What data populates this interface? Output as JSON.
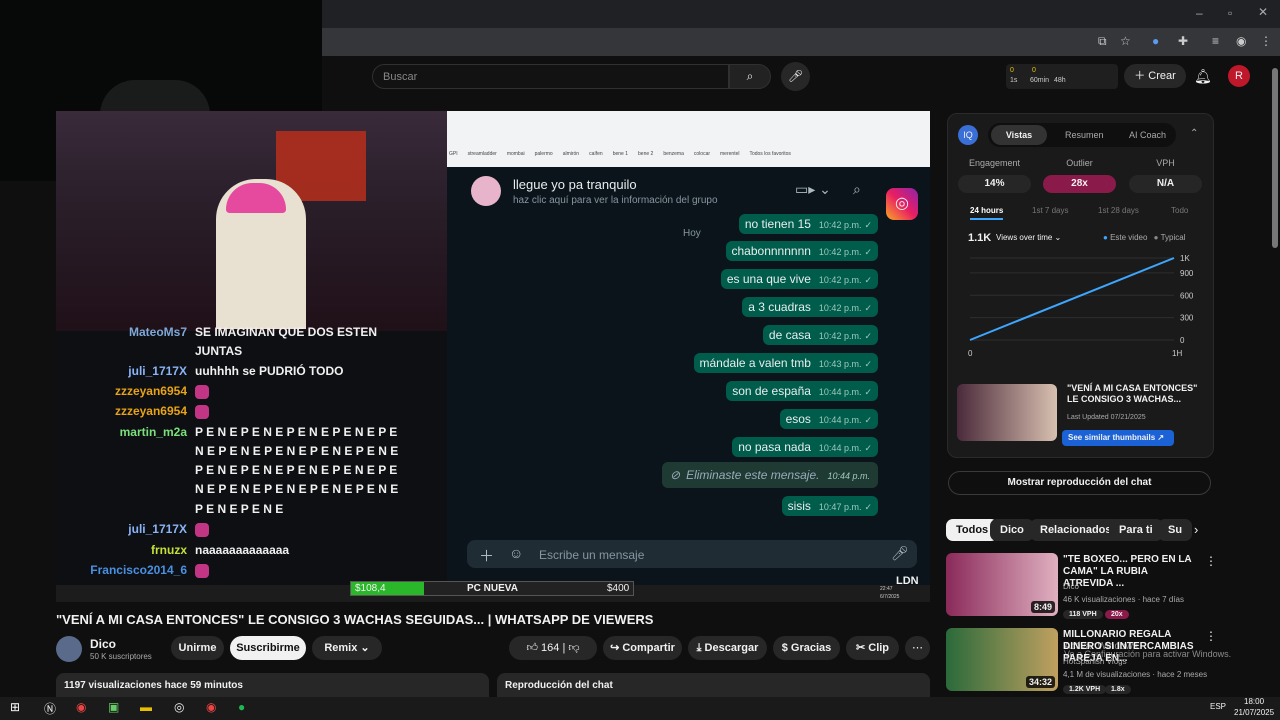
{
  "youtube": {
    "search_placeholder": "Buscar",
    "create_label": "Crear",
    "avatar_letter": "R",
    "ext_stats": [
      "0",
      "0",
      "0",
      "0",
      "1s",
      "60min",
      "48h"
    ]
  },
  "video": {
    "title": "\"VENÍ A MI CASA ENTONCES\" LE CONSIGO 3 WACHAS SEGUIDAS... | WHATSAPP DE VIEWERS",
    "channel": "Dico",
    "subs": "50 K suscriptores",
    "join": "Unirme",
    "subscribe": "Suscribirme",
    "remix": "Remix",
    "likes": "164",
    "share": "Compartir",
    "download": "Descargar",
    "thanks": "Gracias",
    "clip": "Clip",
    "views_line": "1197 visualizaciones  hace 59 minutos",
    "chat_replay": "Reproducción del chat"
  },
  "stream_chat": [
    {
      "user": "MateoMs7",
      "msg": "SE IMAGINAN QUE DOS ESTEN",
      "color": "#7fa8d8"
    },
    {
      "user": "",
      "msg": "JUNTAS",
      "color": "#7fa8d8"
    },
    {
      "user": "juli_1717X",
      "msg": "uuhhhh se PUDRIÓ TODO",
      "color": "#8ab4f8"
    },
    {
      "user": "zzzeyan6954",
      "msg": "",
      "color": "#e8a317"
    },
    {
      "user": "zzzeyan6954",
      "msg": "",
      "color": "#e8a317"
    },
    {
      "user": "martin_m2a",
      "msg": "P E N E P E N E P E N E P E N E P E",
      "color": "#7be07b"
    },
    {
      "user": "",
      "msg": "N E P E N E P E N E P E N E P E N E",
      "color": "#7be07b"
    },
    {
      "user": "",
      "msg": "P E N E P E N E P E N E P E N E P E",
      "color": "#7be07b"
    },
    {
      "user": "",
      "msg": "N E P E N E P E N E P E N E P E N E",
      "color": "#7be07b"
    },
    {
      "user": "",
      "msg": "P E N E P E N E",
      "color": "#7be07b"
    },
    {
      "user": "juli_1717X",
      "msg": "",
      "color": "#8ab4f8"
    },
    {
      "user": "frnuzx",
      "msg": "naaaaaaaaaaaaa",
      "color": "#c6e03b"
    },
    {
      "user": "Francisco2014_6",
      "msg": "",
      "color": "#4a90e2"
    }
  ],
  "whatsapp": {
    "contact": "llegue yo pa tranquilo",
    "subtitle": "haz clic aquí para ver la información del grupo",
    "day": "Hoy",
    "input_placeholder": "Escribe un mensaje",
    "deleted": "Eliminaste este mensaje.",
    "messages": [
      {
        "text": "no tienen 15",
        "time": "10:42 p.m."
      },
      {
        "text": "chabonnnnnnn",
        "time": "10:42 p.m."
      },
      {
        "text": "es una que vive",
        "time": "10:42 p.m."
      },
      {
        "text": "a 3 cuadras",
        "time": "10:42 p.m."
      },
      {
        "text": "de casa",
        "time": "10:42 p.m."
      },
      {
        "text": "mándale a valen tmb",
        "time": "10:43 p.m."
      },
      {
        "text": "son de españa",
        "time": "10:44 p.m."
      },
      {
        "text": "esos",
        "time": "10:44 p.m."
      },
      {
        "text": "no pasa nada",
        "time": "10:44 p.m."
      },
      {
        "text": "Eliminaste este mensaje.",
        "time": "10:44 p.m."
      },
      {
        "text": "sisis",
        "time": "10:47 p.m."
      }
    ],
    "bookmarks": [
      "GPI",
      "streamladder",
      "mombai",
      "palermo",
      "almirón",
      "caífen",
      "bene 1",
      "bene 2",
      "benzema",
      "colocar",
      "merentel",
      "Todos los favoritos"
    ]
  },
  "stream_overlay": {
    "money1": "$108,4",
    "label": "PC NUEVA",
    "money2": "$400",
    "time": "22:47",
    "date": "6/7/2025",
    "ldn": "LDN"
  },
  "sidepanel": {
    "tabs": [
      "Vistas",
      "Resumen",
      "AI Coach"
    ],
    "metrics": [
      {
        "label": "Engagement",
        "value": "14%"
      },
      {
        "label": "Outlier",
        "value": "28x"
      },
      {
        "label": "VPH",
        "value": "N/A"
      }
    ],
    "ranges": [
      "24 hours",
      "1st 7 days",
      "1st 28 days",
      "Todo"
    ],
    "views": "1.1K",
    "views_sel": "Views over time",
    "legend": [
      "Este video",
      "Typical"
    ],
    "y_ticks": [
      "1K",
      "900",
      "600",
      "300",
      "0"
    ],
    "x_ticks": [
      "0",
      "1H"
    ],
    "card_title": "\"VENÍ A MI CASA ENTONCES\" LE CONSIGO 3 WACHAS...",
    "card_updated": "Last Updated 07/21/2025",
    "card_button": "See similar thumbnails"
  },
  "chart_data": {
    "type": "line",
    "x": [
      0,
      1
    ],
    "series": [
      {
        "name": "Este video",
        "values": [
          0,
          1100
        ]
      }
    ],
    "xlabel": "",
    "ylabel": "",
    "ylim": [
      0,
      1100
    ],
    "x_ticks": [
      "0",
      "1H"
    ],
    "y_ticks": [
      "0",
      "300",
      "600",
      "900",
      "1K"
    ]
  },
  "replay_button": "Mostrar reproducción del chat",
  "filters": [
    "Todos",
    "Dico",
    "Relacionados",
    "Para ti",
    "Su"
  ],
  "recs": [
    {
      "title": "\"TE BOXEO... PERO EN LA CAMA\" LA RUBIA ATREVIDA ...",
      "channel": "Dico",
      "meta": "46 K visualizaciones · hace 7 días",
      "vph": "118 VPH",
      "mult": "20x",
      "duration": "8:49"
    },
    {
      "title": "MILLONARIO REGALA DINERO SI INTERCAMBIAS PAREJA EN...",
      "channel": "HotSpanish Vlogs",
      "meta": "4,1 M de visualizaciones · hace 2 meses",
      "vph": "1.2K VPH",
      "mult": "1.8x",
      "duration": "34:32"
    }
  ],
  "watermark": [
    "Activar Windows",
    "Ve a Configuración para activar Windows."
  ],
  "taskbar": {
    "time": "18:00",
    "date": "21/07/2025",
    "lang": "ESP"
  }
}
